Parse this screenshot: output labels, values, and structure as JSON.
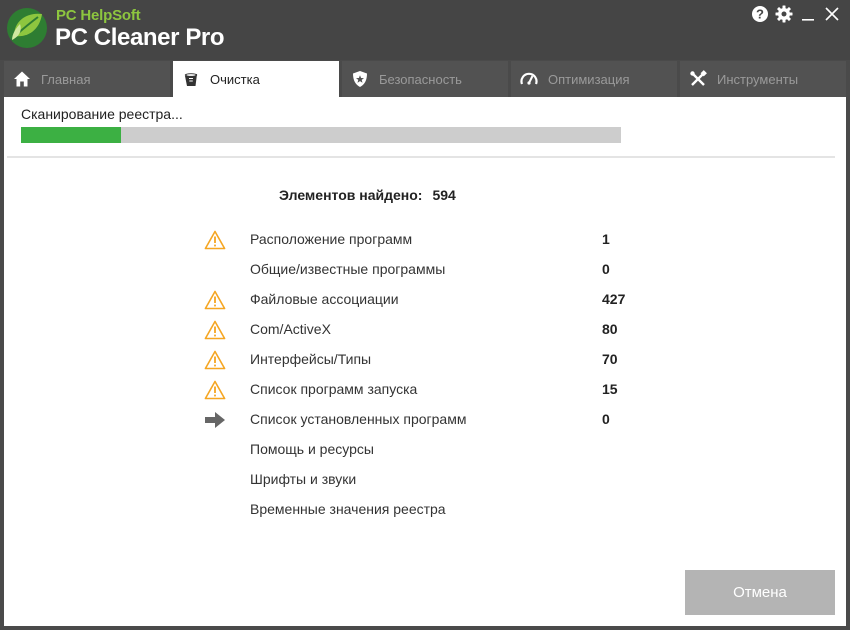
{
  "app": {
    "brand_top": "PC HelpSoft",
    "brand_main": "PC Cleaner Pro"
  },
  "window_controls": [
    "help-icon",
    "settings-icon",
    "minimize-icon",
    "close-icon"
  ],
  "tabs": [
    {
      "label": "Главная",
      "icon": "home-icon",
      "active": false
    },
    {
      "label": "Очистка",
      "icon": "cleaner-icon",
      "active": true
    },
    {
      "label": "Безопасность",
      "icon": "shield-icon",
      "active": false
    },
    {
      "label": "Оптимизация",
      "icon": "gauge-icon",
      "active": false
    },
    {
      "label": "Инструменты",
      "icon": "tools-icon",
      "active": false
    }
  ],
  "scan": {
    "label": "Сканирование реестра...",
    "progress": 0.167
  },
  "summary": {
    "label": "Элементов найдено:",
    "value": "594"
  },
  "items": [
    {
      "label": "Расположение программ",
      "count": "1",
      "status": "warning-icon"
    },
    {
      "label": "Общие/известные программы",
      "count": "0",
      "status": ""
    },
    {
      "label": "Файловые ассоциации",
      "count": "427",
      "status": "warning-icon"
    },
    {
      "label": "Com/ActiveX",
      "count": "80",
      "status": "warning-icon"
    },
    {
      "label": "Интерфейсы/Типы",
      "count": "70",
      "status": "warning-icon"
    },
    {
      "label": "Список программ запуска",
      "count": "15",
      "status": "warning-icon"
    },
    {
      "label": "Список установленных программ",
      "count": "0",
      "status": "arrow-right-icon"
    },
    {
      "label": "Помощь и ресурсы",
      "count": "",
      "status": ""
    },
    {
      "label": "Шрифты и звуки",
      "count": "",
      "status": ""
    },
    {
      "label": "Временные значения реестра",
      "count": "",
      "status": ""
    }
  ],
  "cancel_label": "Отмена",
  "colors": {
    "accent_green": "#3cb043",
    "brand_green": "#8dc63f",
    "warning": "#f5a623",
    "titlebar": "#454545"
  }
}
